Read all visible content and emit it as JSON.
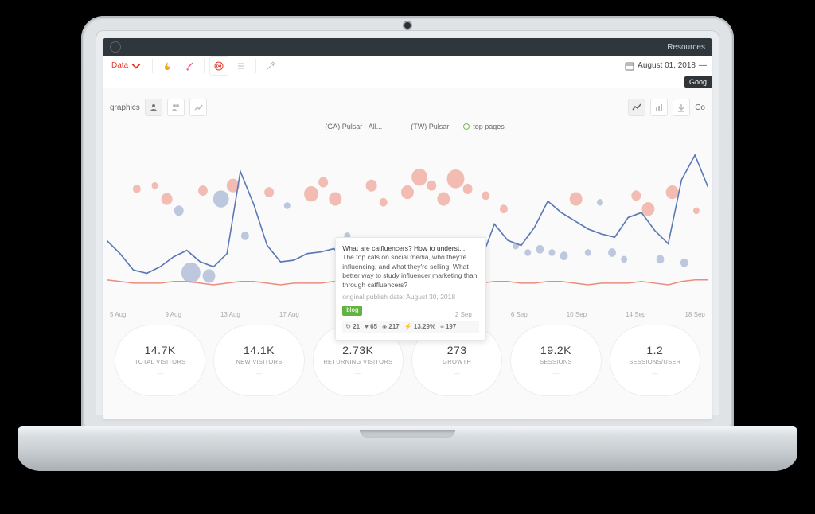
{
  "topbar": {
    "resources_label": "Resources"
  },
  "menubar": {
    "data_label": "Data",
    "date_label": "August 01, 2018"
  },
  "corner_tag": "Goog",
  "subbar": {
    "left_label": "graphics",
    "right_label": "Co"
  },
  "legend": {
    "series_a": "(GA) Pulsar - All...",
    "series_b": "(TW) Pulsar",
    "series_c": "top pages"
  },
  "tooltip": {
    "title": "What are catfluencers? How to underst...",
    "body": "The top cats on social media, who they're influencing, and what they're selling. What better way to study influencer marketing than through catfluencers?",
    "publish_prefix": "original publish date:",
    "publish_date": "August 30, 2018",
    "badge": "blog",
    "stats": {
      "retweets": "21",
      "favs": "65",
      "views": "217",
      "rate": "13.29%",
      "other": "197"
    }
  },
  "chart_data": {
    "type": "line",
    "x_ticks": [
      "5 Aug",
      "9 Aug",
      "13 Aug",
      "17 Aug",
      "",
      "",
      "",
      "2 Sep",
      "6 Sep",
      "10 Sep",
      "14 Sep",
      "18 Sep"
    ],
    "note": "x spans 5 Aug – ~18 Sep 2018; y is a normalized traffic/engagement index ~0–100 (no axis labels shown)",
    "series": [
      {
        "name": "(GA) Pulsar - All...",
        "color": "#5b79b5",
        "values": [
          38,
          30,
          20,
          18,
          22,
          28,
          32,
          25,
          22,
          30,
          80,
          60,
          35,
          25,
          26,
          30,
          31,
          33,
          25,
          22,
          24,
          21,
          24,
          21,
          18,
          22,
          35,
          28,
          26,
          48,
          38,
          35,
          46,
          62,
          55,
          50,
          45,
          42,
          40,
          52,
          55,
          44,
          36,
          75,
          90,
          70
        ]
      },
      {
        "name": "(TW) Pulsar",
        "color": "#e98c7e",
        "values": [
          14,
          13,
          12,
          12,
          12,
          13,
          13,
          12,
          11,
          12,
          13,
          13,
          12,
          11,
          12,
          12,
          12,
          13,
          12,
          11,
          12,
          12,
          13,
          12,
          11,
          11,
          12,
          12,
          12,
          13,
          13,
          12,
          12,
          13,
          13,
          12,
          11,
          12,
          12,
          12,
          13,
          12,
          11,
          13,
          14,
          14
        ]
      }
    ],
    "bubbles_top_pages": [
      {
        "x": 0.05,
        "y": 0.68,
        "r": 5,
        "c": "#f0a79a"
      },
      {
        "x": 0.08,
        "y": 0.7,
        "r": 4,
        "c": "#f0a79a"
      },
      {
        "x": 0.1,
        "y": 0.62,
        "r": 7,
        "c": "#f0a79a"
      },
      {
        "x": 0.12,
        "y": 0.55,
        "r": 6,
        "c": "#a8b7d6"
      },
      {
        "x": 0.16,
        "y": 0.67,
        "r": 6,
        "c": "#f0a79a"
      },
      {
        "x": 0.19,
        "y": 0.62,
        "r": 10,
        "c": "#a8b7d6"
      },
      {
        "x": 0.21,
        "y": 0.7,
        "r": 8,
        "c": "#f0a79a"
      },
      {
        "x": 0.23,
        "y": 0.4,
        "r": 5,
        "c": "#a8b7d6"
      },
      {
        "x": 0.27,
        "y": 0.66,
        "r": 6,
        "c": "#f0a79a"
      },
      {
        "x": 0.3,
        "y": 0.58,
        "r": 4,
        "c": "#a8b7d6"
      },
      {
        "x": 0.34,
        "y": 0.65,
        "r": 9,
        "c": "#f0a79a"
      },
      {
        "x": 0.36,
        "y": 0.72,
        "r": 6,
        "c": "#f0a79a"
      },
      {
        "x": 0.38,
        "y": 0.62,
        "r": 8,
        "c": "#f0a79a"
      },
      {
        "x": 0.4,
        "y": 0.4,
        "r": 4,
        "c": "#a8b7d6"
      },
      {
        "x": 0.44,
        "y": 0.7,
        "r": 7,
        "c": "#f0a79a"
      },
      {
        "x": 0.46,
        "y": 0.6,
        "r": 5,
        "c": "#f0a79a"
      },
      {
        "x": 0.5,
        "y": 0.66,
        "r": 8,
        "c": "#f0a79a"
      },
      {
        "x": 0.52,
        "y": 0.75,
        "r": 10,
        "c": "#f0a79a"
      },
      {
        "x": 0.54,
        "y": 0.7,
        "r": 6,
        "c": "#f0a79a"
      },
      {
        "x": 0.56,
        "y": 0.62,
        "r": 8,
        "c": "#f0a79a"
      },
      {
        "x": 0.58,
        "y": 0.74,
        "r": 11,
        "c": "#f0a79a"
      },
      {
        "x": 0.6,
        "y": 0.68,
        "r": 6,
        "c": "#f0a79a"
      },
      {
        "x": 0.63,
        "y": 0.64,
        "r": 5,
        "c": "#f0a79a"
      },
      {
        "x": 0.66,
        "y": 0.56,
        "r": 5,
        "c": "#f0a79a"
      },
      {
        "x": 0.68,
        "y": 0.34,
        "r": 4,
        "c": "#a8b7d6"
      },
      {
        "x": 0.7,
        "y": 0.3,
        "r": 4,
        "c": "#a8b7d6"
      },
      {
        "x": 0.72,
        "y": 0.32,
        "r": 5,
        "c": "#a8b7d6"
      },
      {
        "x": 0.74,
        "y": 0.3,
        "r": 4,
        "c": "#a8b7d6"
      },
      {
        "x": 0.76,
        "y": 0.28,
        "r": 5,
        "c": "#a8b7d6"
      },
      {
        "x": 0.78,
        "y": 0.62,
        "r": 8,
        "c": "#f0a79a"
      },
      {
        "x": 0.8,
        "y": 0.3,
        "r": 4,
        "c": "#a8b7d6"
      },
      {
        "x": 0.82,
        "y": 0.6,
        "r": 4,
        "c": "#a8b7d6"
      },
      {
        "x": 0.84,
        "y": 0.3,
        "r": 5,
        "c": "#a8b7d6"
      },
      {
        "x": 0.86,
        "y": 0.26,
        "r": 4,
        "c": "#a8b7d6"
      },
      {
        "x": 0.88,
        "y": 0.64,
        "r": 6,
        "c": "#f0a79a"
      },
      {
        "x": 0.9,
        "y": 0.56,
        "r": 8,
        "c": "#f0a79a"
      },
      {
        "x": 0.92,
        "y": 0.26,
        "r": 5,
        "c": "#a8b7d6"
      },
      {
        "x": 0.94,
        "y": 0.66,
        "r": 8,
        "c": "#f0a79a"
      },
      {
        "x": 0.96,
        "y": 0.24,
        "r": 5,
        "c": "#a8b7d6"
      },
      {
        "x": 0.98,
        "y": 0.55,
        "r": 4,
        "c": "#f0a79a"
      },
      {
        "x": 0.14,
        "y": 0.18,
        "r": 12,
        "c": "#a8b7d6"
      },
      {
        "x": 0.17,
        "y": 0.16,
        "r": 8,
        "c": "#a8b7d6"
      },
      {
        "x": 0.55,
        "y": 0.18,
        "r": 12,
        "c": "#a8b7d6"
      },
      {
        "x": 0.57,
        "y": 0.2,
        "r": 6,
        "c": "#a8b7d6"
      }
    ]
  },
  "metrics": [
    {
      "value": "14.7K",
      "label": "TOTAL VISITORS"
    },
    {
      "value": "14.1K",
      "label": "NEW VISITORS"
    },
    {
      "value": "2.73K",
      "label": "RETURNING VISITORS"
    },
    {
      "value": "273",
      "label": "GROWTH"
    },
    {
      "value": "19.2K",
      "label": "SESSIONS"
    },
    {
      "value": "1.2",
      "label": "SESSIONS/USER"
    }
  ]
}
